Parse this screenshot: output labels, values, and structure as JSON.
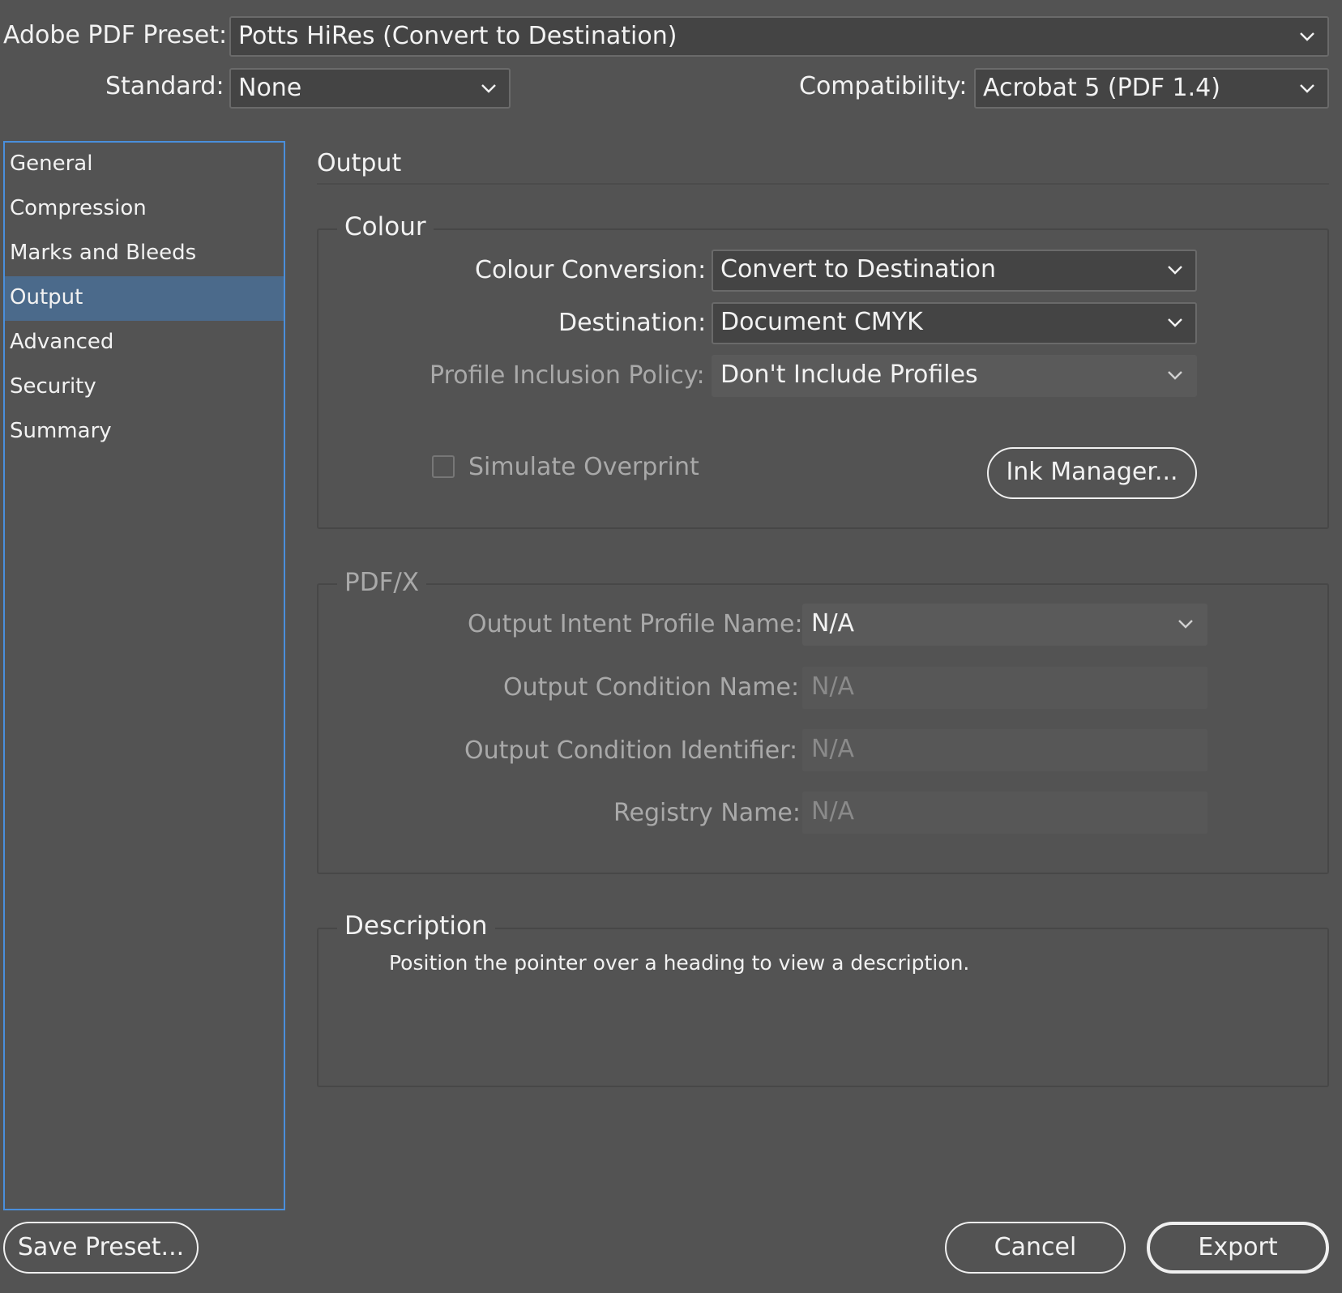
{
  "header": {
    "preset_label": "Adobe PDF Preset:",
    "preset_value": "Potts HiRes (Convert to Destination)",
    "standard_label": "Standard:",
    "standard_value": "None",
    "compat_label": "Compatibility:",
    "compat_value": "Acrobat 5 (PDF 1.4)"
  },
  "sidebar": {
    "items": [
      {
        "label": "General"
      },
      {
        "label": "Compression"
      },
      {
        "label": "Marks and Bleeds"
      },
      {
        "label": "Output",
        "active": true
      },
      {
        "label": "Advanced"
      },
      {
        "label": "Security"
      },
      {
        "label": "Summary"
      }
    ]
  },
  "main": {
    "title": "Output",
    "colour": {
      "title": "Colour",
      "conversion_label": "Colour Conversion:",
      "conversion_value": "Convert to Destination",
      "destination_label": "Destination:",
      "destination_value": "Document CMYK",
      "profile_label": "Profile Inclusion Policy:",
      "profile_value": "Don't Include Profiles",
      "simulate_label": "Simulate Overprint",
      "simulate_checked": false,
      "ink_manager": "Ink Manager..."
    },
    "pdfx": {
      "title": "PDF/X",
      "intent_label": "Output Intent Profile Name:",
      "intent_value": "N/A",
      "condition_name_label": "Output Condition Name:",
      "condition_name_value": "N/A",
      "condition_id_label": "Output Condition Identifier:",
      "condition_id_value": "N/A",
      "registry_label": "Registry Name:",
      "registry_value": "N/A"
    },
    "description": {
      "title": "Description",
      "text": "Position the pointer over a heading to view a description."
    }
  },
  "footer": {
    "save_preset": "Save Preset...",
    "cancel": "Cancel",
    "export": "Export"
  },
  "colors": {
    "background": "#535353",
    "selection": "#4b6a8b",
    "focus_ring": "#4a8fdc"
  }
}
